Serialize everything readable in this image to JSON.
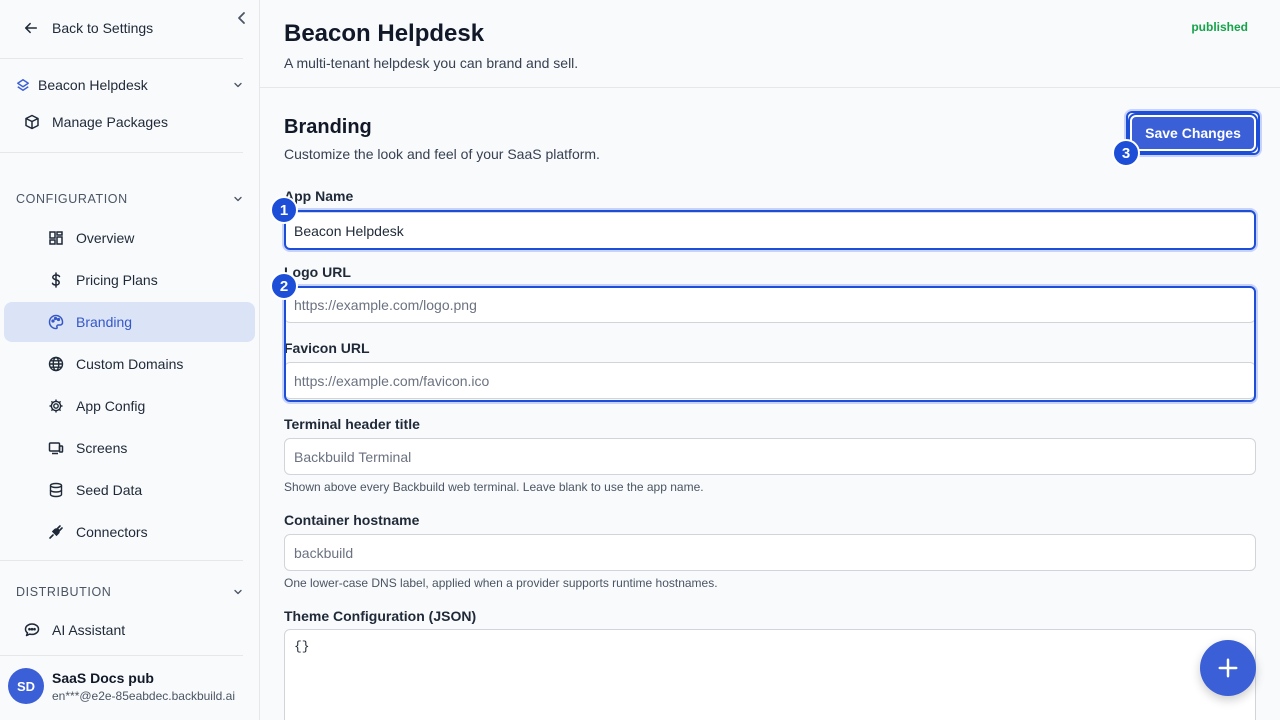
{
  "sidebar": {
    "back_label": "Back to Settings",
    "project_name": "Beacon Helpdesk",
    "manage_packages": "Manage Packages",
    "configuration_label": "CONFIGURATION",
    "nav": [
      {
        "label": "Overview",
        "icon": "dashboard-icon"
      },
      {
        "label": "Pricing Plans",
        "icon": "dollar-icon"
      },
      {
        "label": "Branding",
        "icon": "palette-icon",
        "active": true
      },
      {
        "label": "Custom Domains",
        "icon": "globe-icon"
      },
      {
        "label": "App Config",
        "icon": "gear-icon"
      },
      {
        "label": "Screens",
        "icon": "screens-icon"
      },
      {
        "label": "Seed Data",
        "icon": "database-icon"
      },
      {
        "label": "Connectors",
        "icon": "plug-icon"
      }
    ],
    "distribution_label": "DISTRIBUTION",
    "ai_assistant": "AI Assistant",
    "user": {
      "initials": "SD",
      "name": "SaaS Docs pub",
      "email": "en***@e2e-85eabdec.backbuild.ai"
    }
  },
  "header": {
    "title": "Beacon Helpdesk",
    "subtitle": "A multi-tenant helpdesk you can brand and sell.",
    "status": "published"
  },
  "branding": {
    "title": "Branding",
    "subtitle": "Customize the look and feel of your SaaS platform.",
    "save_label": "Save Changes",
    "app_name_label": "App Name",
    "app_name_value": "Beacon Helpdesk",
    "logo_label": "Logo URL",
    "logo_placeholder": "https://example.com/logo.png",
    "favicon_label": "Favicon URL",
    "favicon_placeholder": "https://example.com/favicon.ico",
    "terminal_label": "Terminal header title",
    "terminal_placeholder": "Backbuild Terminal",
    "terminal_hint": "Shown above every Backbuild web terminal. Leave blank to use the app name.",
    "hostname_label": "Container hostname",
    "hostname_placeholder": "backbuild",
    "hostname_hint": "One lower-case DNS label, applied when a provider supports runtime hostnames.",
    "theme_label": "Theme Configuration (JSON)",
    "theme_value": "{}"
  },
  "markers": [
    "1",
    "2",
    "3"
  ],
  "colors": {
    "accent": "#3b5fd6",
    "active_bg": "#dbe4f7",
    "published": "#16a34a",
    "highlight": "#1d4ed8"
  }
}
